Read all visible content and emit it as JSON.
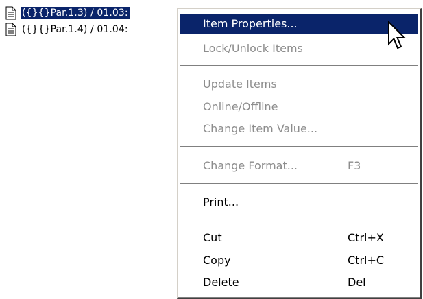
{
  "tree": {
    "items": [
      {
        "label": "({}{}Par.1.3) / 01.03:",
        "selected": true,
        "icon": "document-icon"
      },
      {
        "label": "({}{}Par.1.4) / 01.04:",
        "selected": false,
        "icon": "document-icon"
      }
    ]
  },
  "context_menu": {
    "items": [
      {
        "label": "Item Properties...",
        "shortcut": "",
        "state": "highlighted"
      },
      {
        "label": "Lock/Unlock Items",
        "shortcut": "",
        "state": "disabled"
      },
      {
        "label": "Update Items",
        "shortcut": "",
        "state": "disabled"
      },
      {
        "label": "Online/Offline",
        "shortcut": "",
        "state": "disabled"
      },
      {
        "label": "Change Item Value...",
        "shortcut": "",
        "state": "disabled"
      },
      {
        "label": "Change Format...",
        "shortcut": "F3",
        "state": "disabled"
      },
      {
        "label": "Print...",
        "shortcut": "",
        "state": "enabled"
      },
      {
        "label": "Cut",
        "shortcut": "Ctrl+X",
        "state": "enabled"
      },
      {
        "label": "Copy",
        "shortcut": "Ctrl+C",
        "state": "enabled"
      },
      {
        "label": "Delete",
        "shortcut": "Del",
        "state": "enabled"
      }
    ]
  },
  "colors": {
    "selection": "#0a246a",
    "disabled_text": "#8d8d8d"
  }
}
